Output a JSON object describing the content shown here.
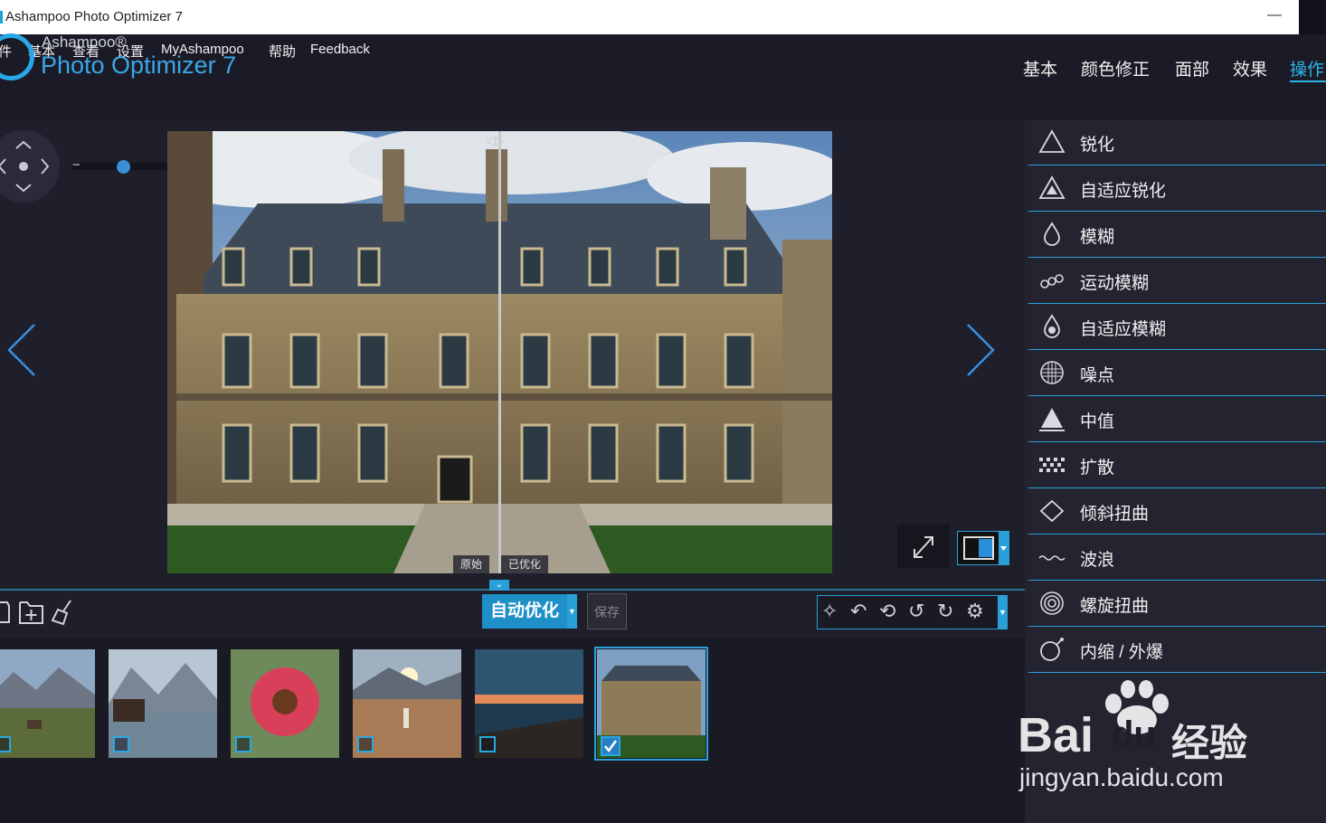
{
  "window": {
    "title": "Ashampoo Photo Optimizer 7",
    "minimize": "—"
  },
  "menu": [
    "件",
    "基本",
    "查看",
    "设置",
    "MyAshampoo",
    "帮助",
    "Feedback"
  ],
  "logo": {
    "brand": "Ashampoo®",
    "product": "Photo Optimizer 7"
  },
  "top_tabs": [
    {
      "label": "基本",
      "active": false
    },
    {
      "label": "颜色修正",
      "active": false
    },
    {
      "label": "面部",
      "active": false
    },
    {
      "label": "效果",
      "active": false
    },
    {
      "label": "操作",
      "active": true
    }
  ],
  "zoom": {
    "minus": "−",
    "plus": "+",
    "level": 0.35
  },
  "compare": {
    "original_label": "原始",
    "optimized_label": "已优化",
    "split_position": 0.5
  },
  "toolbar": {
    "auto_optimize": "自动优化",
    "save": "保存"
  },
  "effects": [
    {
      "label": "锐化",
      "icon": "triangle-outline-icon"
    },
    {
      "label": "自适应锐化",
      "icon": "triangle-adaptive-icon"
    },
    {
      "label": "模糊",
      "icon": "drop-outline-icon"
    },
    {
      "label": "运动模糊",
      "icon": "motion-drops-icon"
    },
    {
      "label": "自适应模糊",
      "icon": "drop-adaptive-icon"
    },
    {
      "label": "噪点",
      "icon": "noise-sphere-icon"
    },
    {
      "label": "中值",
      "icon": "median-triangle-icon"
    },
    {
      "label": "扩散",
      "icon": "diffuse-dots-icon"
    },
    {
      "label": "倾斜扭曲",
      "icon": "diamond-icon"
    },
    {
      "label": "波浪",
      "icon": "wave-icon"
    },
    {
      "label": "螺旋扭曲",
      "icon": "spiral-icon"
    },
    {
      "label": "内缩 / 外爆",
      "icon": "bomb-icon"
    }
  ],
  "thumbnails": [
    {
      "name": "mountain-meadow",
      "checked": false
    },
    {
      "name": "lake-boathouse",
      "checked": false
    },
    {
      "name": "red-flower",
      "checked": false
    },
    {
      "name": "beach-sunset-person",
      "checked": false
    },
    {
      "name": "sea-sunset",
      "checked": false
    },
    {
      "name": "chateau",
      "checked": true,
      "selected": true
    }
  ],
  "watermark": {
    "brand": "Bai",
    "brand2": "du",
    "cn": "经验",
    "url": "jingyan.baidu.com"
  }
}
